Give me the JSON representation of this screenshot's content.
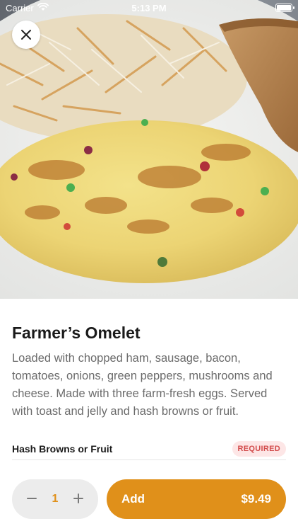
{
  "status_bar": {
    "carrier": "Carrier",
    "time": "5:13 PM",
    "wifi_icon": "wifi-icon",
    "battery_icon": "battery-icon"
  },
  "hero": {
    "close_icon": "close-icon",
    "image_subject": "omelet-photo"
  },
  "item": {
    "title": "Farmer’s Omelet",
    "description": "Loaded with chopped ham, sausage, bacon, tomatoes, onions, green peppers, mushrooms and cheese. Made with three farm-fresh eggs. Served with toast and jelly and hash browns or fruit."
  },
  "options": [
    {
      "label": "Hash Browns or Fruit",
      "badge": "REQUIRED"
    }
  ],
  "footer": {
    "quantity": "1",
    "decrement_icon": "minus-icon",
    "increment_icon": "plus-icon",
    "add_label": "Add",
    "price": "$9.49"
  },
  "colors": {
    "accent": "#e0901a",
    "required_bg": "#fde6e6",
    "required_text": "#d24b4b",
    "stepper_bg": "#ececec"
  }
}
